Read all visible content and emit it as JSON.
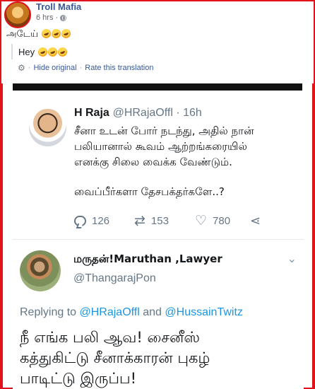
{
  "post": {
    "page_name": "Troll Mafia",
    "time": "6 hrs",
    "sep": "·",
    "text": "அடேய்",
    "translation": "Hey",
    "hide_original": "Hide original",
    "rate_translation": "Rate this translation"
  },
  "tweet1": {
    "name": "H Raja",
    "handle": "@HRajaOffl · 16h",
    "lines": [
      "சீனா உடன் போர் நடந்து, அதில் நான்",
      "பலியானால் கூவம் ஆற்றங்கரையில்",
      "எனக்கு சிலை வைக்க வேண்டும்."
    ],
    "question": "வைப்பீர்களா தேசபக்தர்களே..?",
    "replies": "126",
    "retweets": "153",
    "likes": "780"
  },
  "tweet2": {
    "name": "மருதன்!Maruthan ,Lawyer",
    "handle": "@ThangarajPon",
    "replying_prefix": "Replying to ",
    "mention1": "@HRajaOffl",
    "and": " and ",
    "mention2": "@HussainTwitz",
    "lines": [
      "நீ எங்க பலி ஆவ! சைனீஸ்",
      "கத்துகிட்டு சீனாக்காரன் புகழ்",
      "பாடிட்டு இருப்ப!"
    ]
  },
  "colors": {
    "border_red": "#e0131a",
    "link_blue": "#385898",
    "twitter_blue": "#1b95e0",
    "muted": "#657786"
  },
  "icons": [
    "globe-icon",
    "emoji-icon",
    "gear-icon",
    "reply-icon",
    "retweet-icon",
    "heart-icon",
    "share-icon",
    "chevron-down-icon"
  ]
}
